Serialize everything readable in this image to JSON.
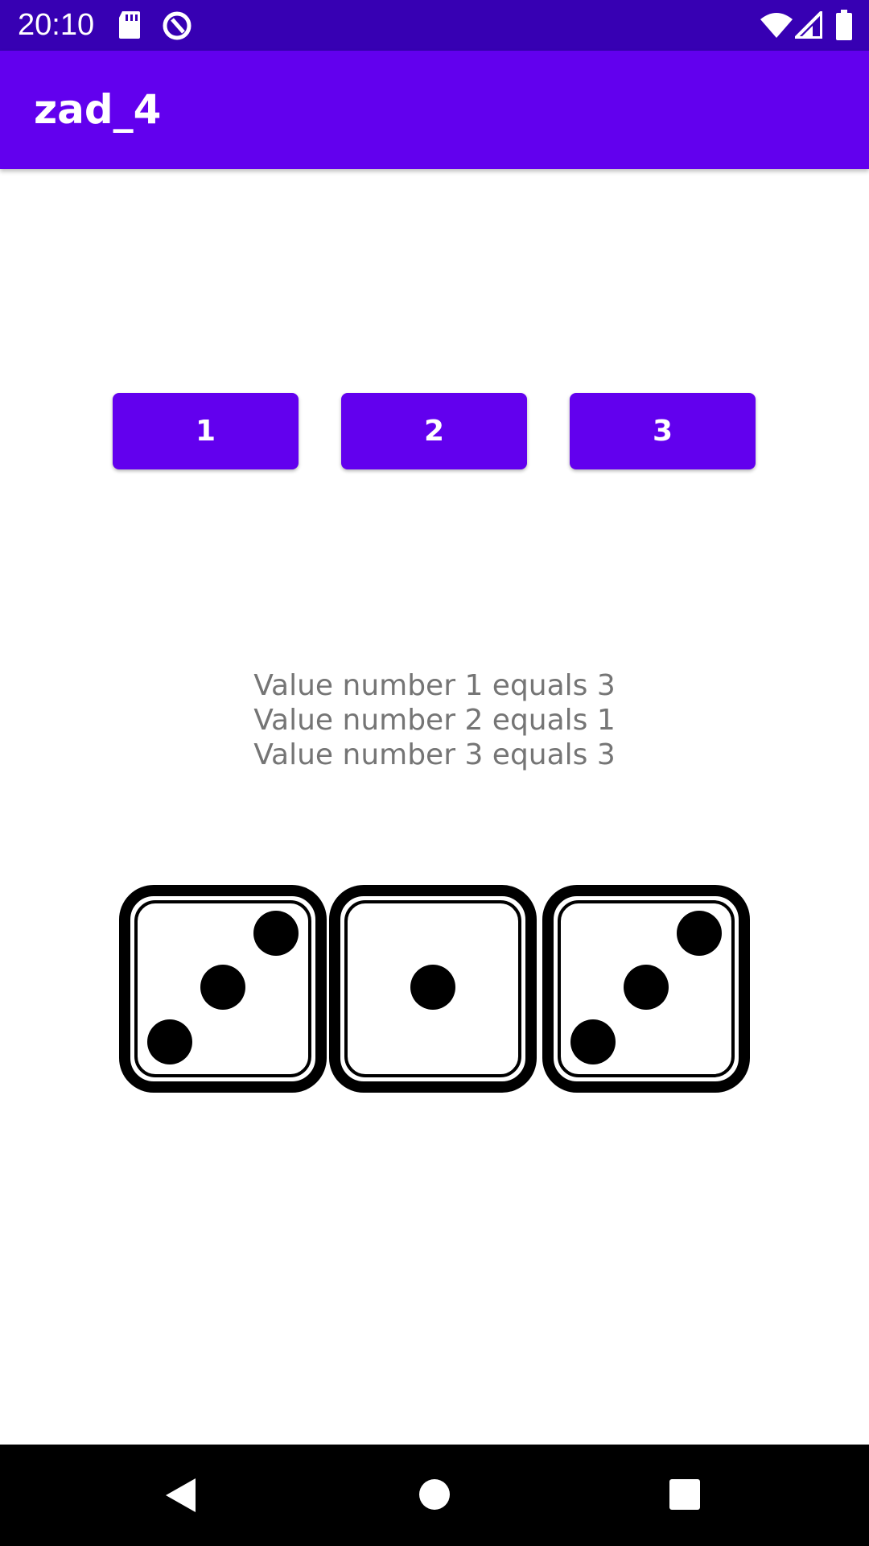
{
  "status_bar": {
    "time": "20:10",
    "icons": [
      "sd-card-icon",
      "data-saver-icon",
      "wifi-icon",
      "signal-icon",
      "battery-icon"
    ]
  },
  "app_bar": {
    "title": "zad_4"
  },
  "buttons": [
    {
      "label": "1"
    },
    {
      "label": "2"
    },
    {
      "label": "3"
    }
  ],
  "values": [
    "Value number 1 equals 3",
    "Value number 2 equals 1",
    "Value number 3 equals 3"
  ],
  "dice": [
    {
      "face": 3
    },
    {
      "face": 1
    },
    {
      "face": 3
    }
  ],
  "nav_bar": {
    "icons": [
      "back-icon",
      "home-icon",
      "recents-icon"
    ]
  },
  "colors": {
    "primary": "#6200ee",
    "primary_dark": "#3700b3",
    "value_text": "#757575"
  }
}
